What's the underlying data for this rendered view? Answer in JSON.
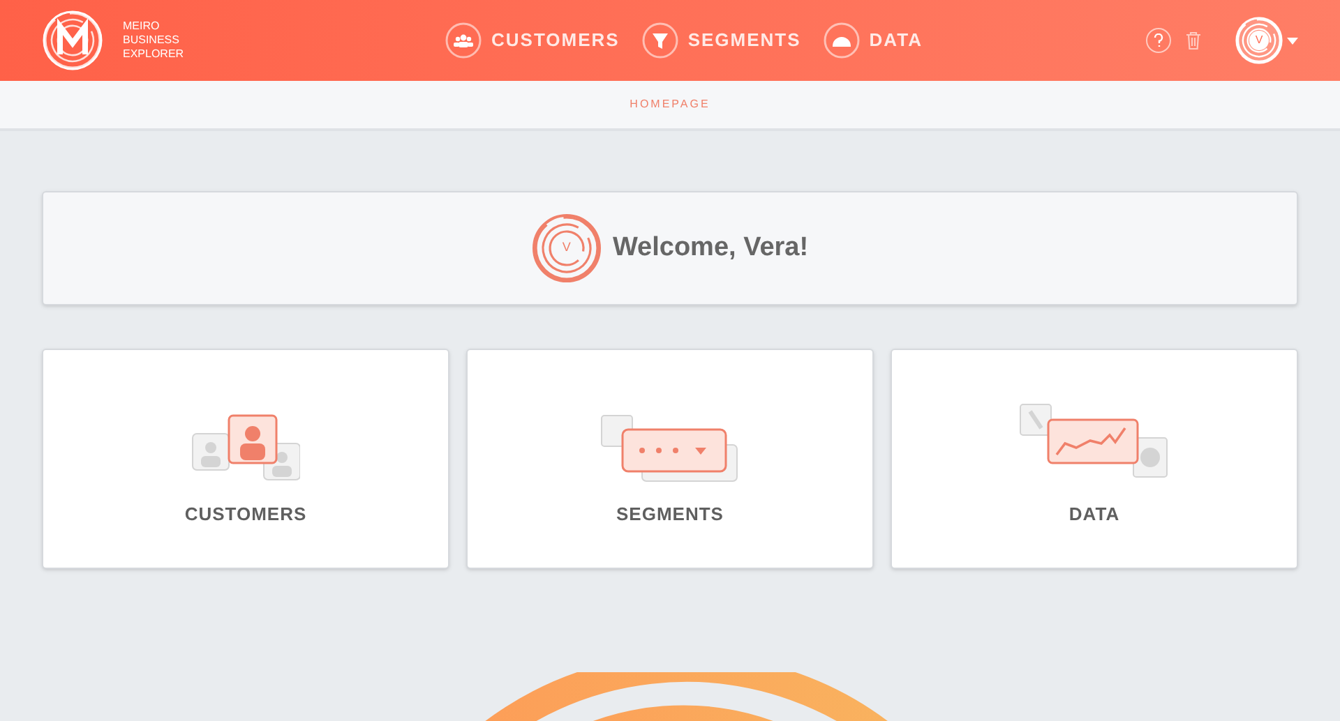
{
  "header": {
    "logo_lines": [
      "MEIRO",
      "BUSINESS",
      "EXPLORER"
    ],
    "nav": [
      {
        "label": "CUSTOMERS",
        "kind": "customers"
      },
      {
        "label": "SEGMENTS",
        "kind": "segments"
      },
      {
        "label": "DATA",
        "kind": "data"
      }
    ],
    "avatar_letter": "V"
  },
  "breadcrumb": "HOMEPAGE",
  "welcome": {
    "avatar_letter": "V",
    "text": "Welcome, **Vera!**"
  },
  "cards": [
    {
      "label": "CUSTOMERS",
      "kind": "customers"
    },
    {
      "label": "SEGMENTS",
      "kind": "segments"
    },
    {
      "label": "DATA",
      "kind": "data"
    }
  ]
}
